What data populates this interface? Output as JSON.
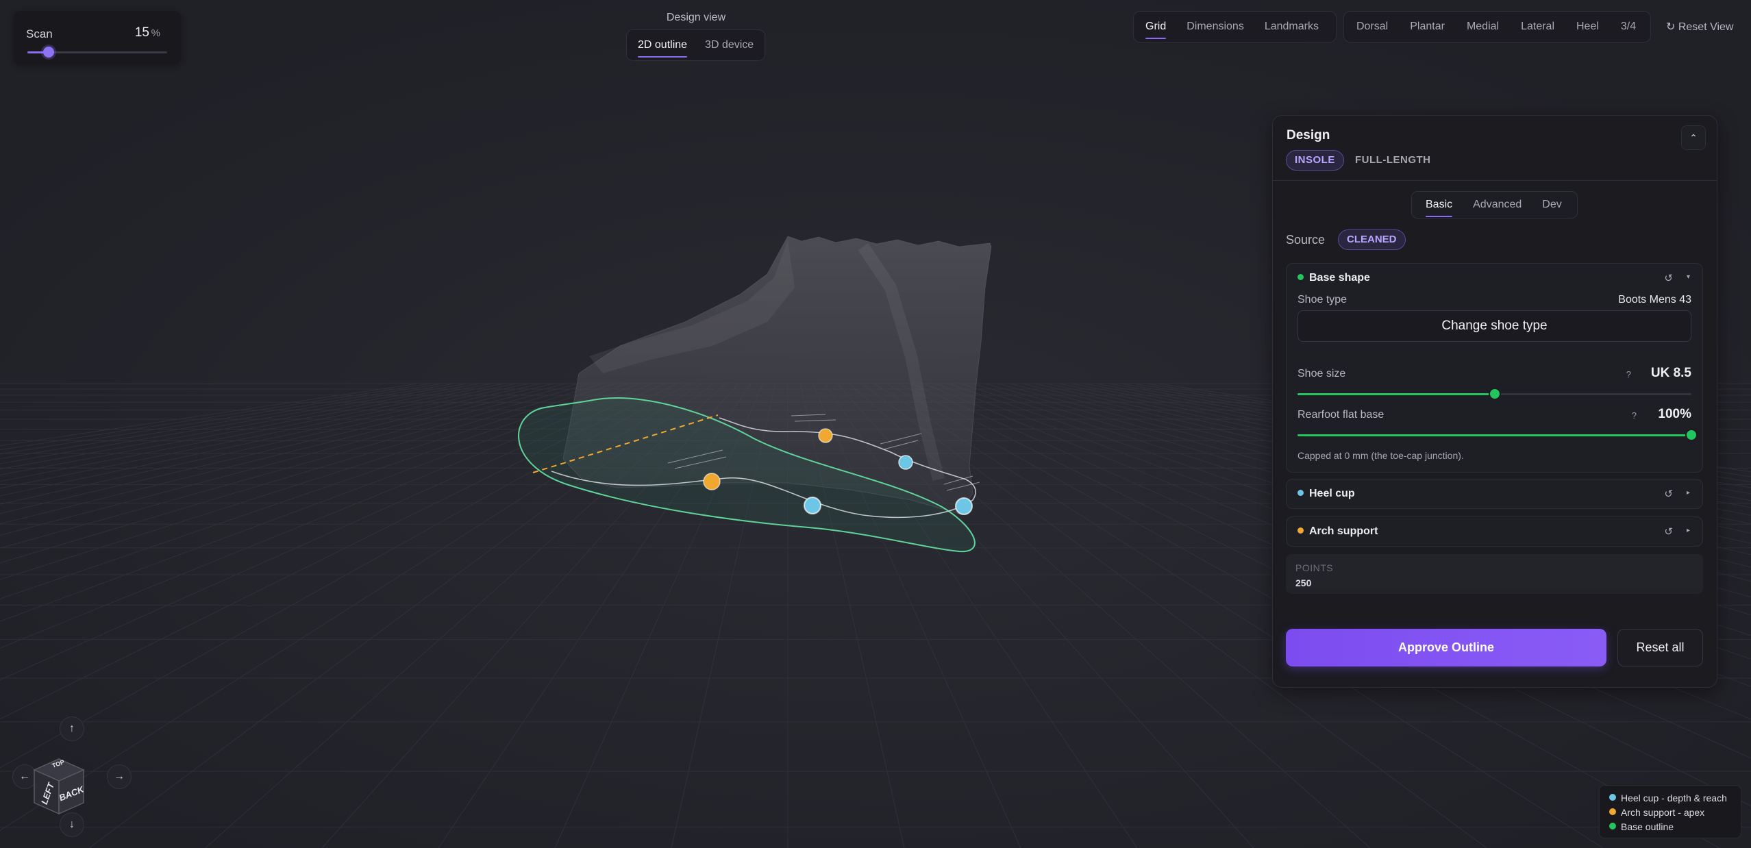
{
  "scan": {
    "label": "Scan",
    "value": "15",
    "unit": "%",
    "level_percent": 15
  },
  "design_view": {
    "label": "Design view",
    "options": [
      "2D outline",
      "3D device"
    ],
    "active": "2D outline"
  },
  "overlay_toolbar": {
    "items": [
      "Grid",
      "Dimensions",
      "Landmarks"
    ],
    "active": "Grid"
  },
  "views_toolbar": {
    "items": [
      "Dorsal",
      "Plantar",
      "Medial",
      "Lateral",
      "Heel",
      "3/4"
    ]
  },
  "reset_view": {
    "label": "↻ Reset View"
  },
  "design_panel": {
    "title": "Design",
    "modes": [
      "INSOLE",
      "FULL-LENGTH"
    ],
    "active_mode": "INSOLE",
    "tabs": [
      "Basic",
      "Advanced",
      "Dev"
    ],
    "active_tab": "Basic",
    "source_label": "Source",
    "source_value": "CLEANED",
    "base_shape": {
      "title": "Base shape",
      "color": "#22c55e",
      "shoe_type_label": "Shoe type",
      "shoe_type_value": "Boots Mens 43",
      "change_button": "Change shoe type",
      "shoe_size_label": "Shoe size",
      "shoe_size_value": "UK 8.5",
      "shoe_size_fraction": 0.5,
      "rearfoot_label": "Rearfoot flat base",
      "rearfoot_value": "100%",
      "rearfoot_fraction": 1.0,
      "help": "?",
      "note": "Capped at 0 mm (the toe-cap junction)."
    },
    "heel_cup": {
      "title": "Heel cup",
      "color": "#6ec6e6"
    },
    "arch_support": {
      "title": "Arch support",
      "color": "#f0a830"
    },
    "points_label": "POINTS",
    "points_value": "250",
    "approve_button": "Approve Outline",
    "reset_button": "Reset all"
  },
  "legend": [
    {
      "label": "Heel cup - depth & reach",
      "color": "#6ec6e6"
    },
    {
      "label": "Arch support - apex",
      "color": "#f0a830"
    },
    {
      "label": "Base outline",
      "color": "#22c55e"
    }
  ],
  "nav_cube": {
    "faces": [
      "LEFT",
      "BACK",
      "TOP"
    ],
    "arrows": {
      "up": "↑",
      "down": "↓",
      "left": "←",
      "right": "→"
    }
  },
  "icons": {
    "reset": "reset-icon",
    "expand": "expand-icon",
    "collapse": "chevron-up-icon"
  },
  "colors": {
    "accent": "#8b6cf2",
    "base_outline": "#22c55e",
    "heel_marker": "#6ec6e6",
    "arch_marker": "#f0a830"
  }
}
